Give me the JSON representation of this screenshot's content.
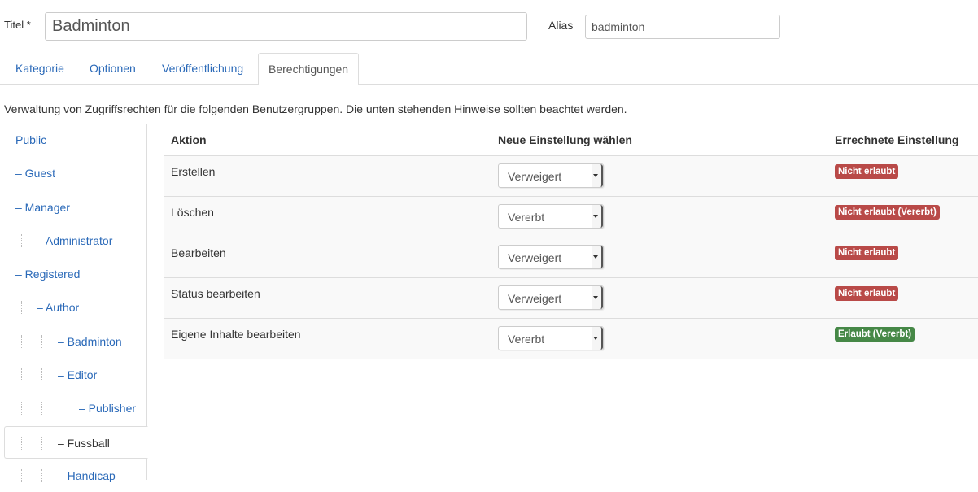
{
  "form": {
    "title_label": "Titel *",
    "title_value": "Badminton",
    "alias_label": "Alias",
    "alias_value": "badminton"
  },
  "tabs": [
    {
      "label": "Kategorie",
      "active": false
    },
    {
      "label": "Optionen",
      "active": false
    },
    {
      "label": "Veröffentlichung",
      "active": false
    },
    {
      "label": "Berechtigungen",
      "active": true
    }
  ],
  "description": "Verwaltung von Zugriffsrechten für die folgenden Benutzergruppen. Die unten stehenden Hinweise sollten beachtet werden.",
  "groups": [
    {
      "label": "Public"
    },
    {
      "label": "– Guest"
    },
    {
      "label": "– Manager"
    },
    {
      "label": "– Administrator"
    },
    {
      "label": "– Registered"
    },
    {
      "label": "– Author"
    },
    {
      "label": "– Badminton"
    },
    {
      "label": "– Editor"
    },
    {
      "label": "– Publisher"
    },
    {
      "label": "– Fussball"
    },
    {
      "label": "– Handicap"
    }
  ],
  "permissions": {
    "headers": {
      "action": "Aktion",
      "setting": "Neue Einstellung wählen",
      "computed": "Errechnete Einstellung"
    },
    "rows": [
      {
        "action": "Erstellen",
        "setting": "Verweigert",
        "computed": "Nicht erlaubt",
        "status": "denied"
      },
      {
        "action": "Löschen",
        "setting": "Vererbt",
        "computed": "Nicht erlaubt (Vererbt)",
        "status": "denied"
      },
      {
        "action": "Bearbeiten",
        "setting": "Verweigert",
        "computed": "Nicht erlaubt",
        "status": "denied"
      },
      {
        "action": "Status bearbeiten",
        "setting": "Verweigert",
        "computed": "Nicht erlaubt",
        "status": "denied"
      },
      {
        "action": "Eigene Inhalte bearbeiten",
        "setting": "Vererbt",
        "computed": "Erlaubt (Vererbt)",
        "status": "allowed"
      }
    ]
  },
  "colors": {
    "link": "#2a69b8",
    "denied": "#b94a48",
    "allowed": "#468847"
  }
}
